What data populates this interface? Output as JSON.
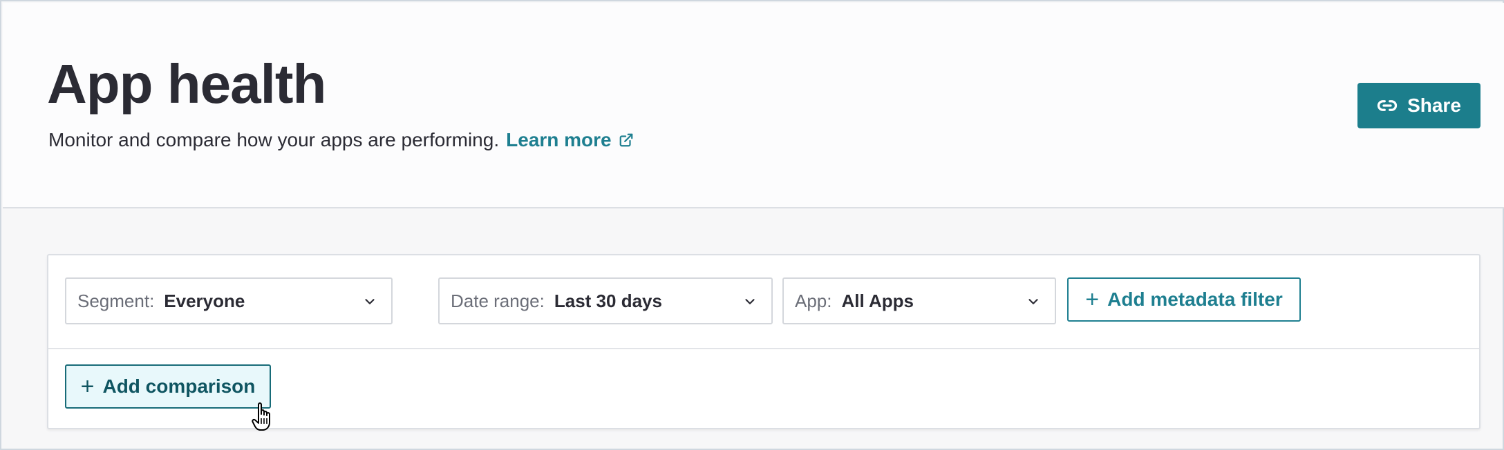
{
  "header": {
    "title": "App health",
    "subtitle": "Monitor and compare how your apps are performing.",
    "learn_more_label": "Learn more",
    "share_label": "Share"
  },
  "filters": {
    "segment": {
      "label": "Segment:",
      "value": "Everyone"
    },
    "date_range": {
      "label": "Date range:",
      "value": "Last 30 days"
    },
    "app": {
      "label": "App:",
      "value": "All Apps"
    },
    "add_metadata_filter_label": "Add metadata filter"
  },
  "comparison": {
    "add_comparison_label": "Add comparison"
  },
  "icons": {
    "share": "link-icon",
    "learn_more": "external-link-icon",
    "dropdown": "chevron-down-icon",
    "add": "plus-icon",
    "cursor": "hand-pointer-icon"
  },
  "colors": {
    "accent": "#1c7e8c",
    "link": "#1e7f90",
    "comparison_bg": "#e8f8fb"
  }
}
